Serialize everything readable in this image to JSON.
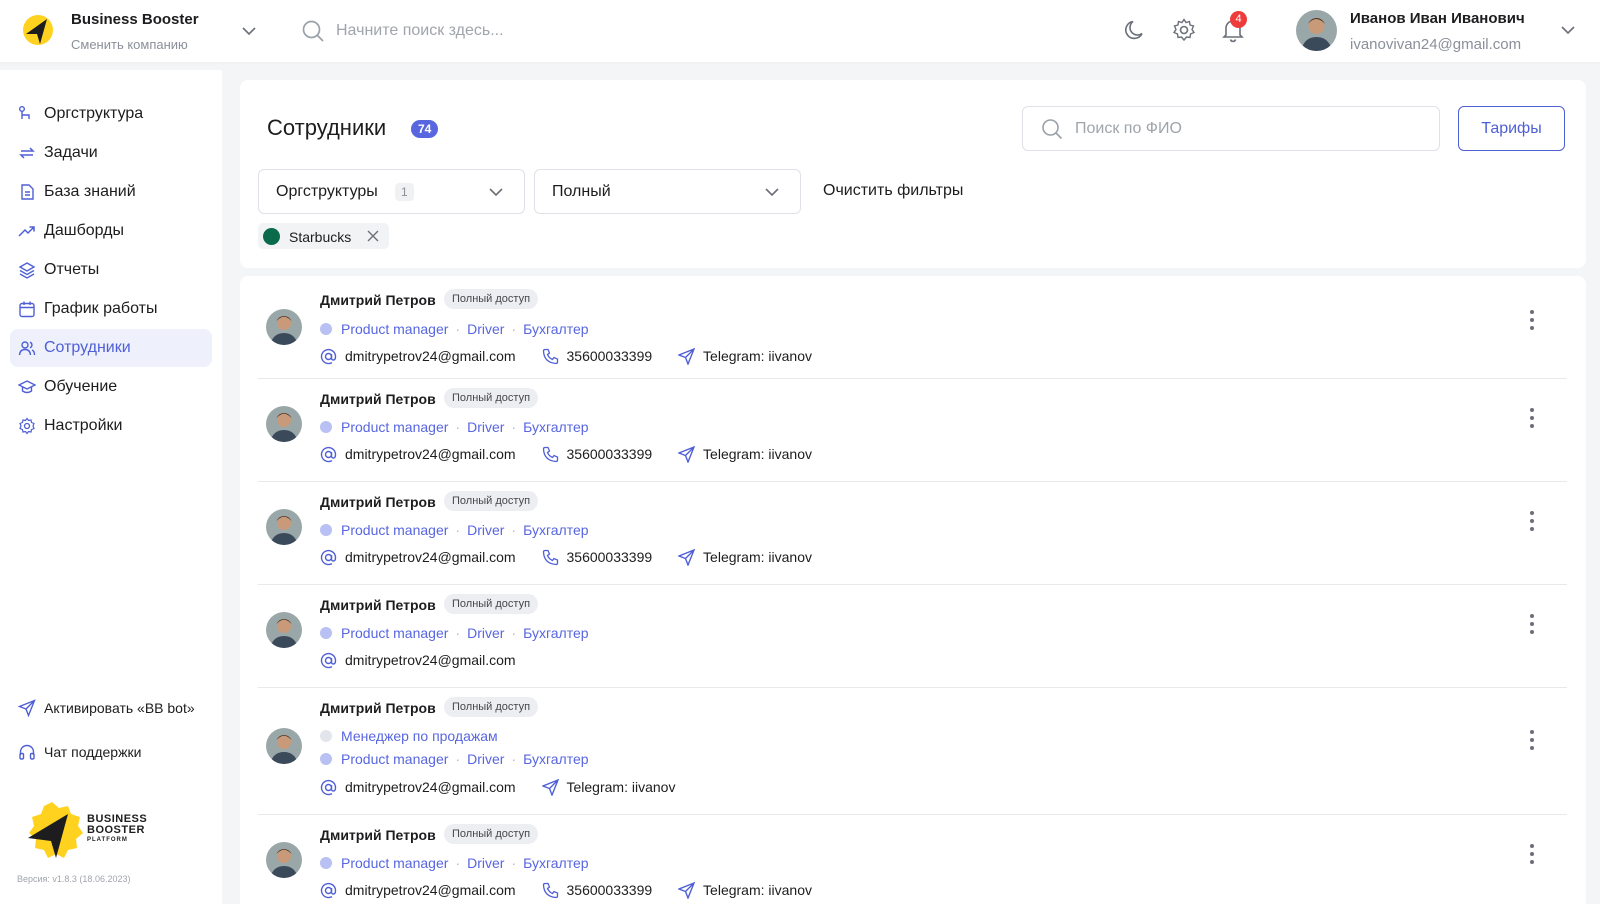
{
  "header": {
    "company_name": "Business Booster",
    "company_switch": "Сменить компанию",
    "search_placeholder": "Начните поиск здесь...",
    "notifications_count": "4",
    "user_name": "Иванов Иван Иванович",
    "user_email": "ivanovivan24@gmail.com",
    "icons": [
      "moon-icon",
      "gear-icon",
      "bell-icon",
      "chevron-down-icon",
      "search-icon"
    ]
  },
  "sidebar": {
    "items": [
      {
        "label": "Оргструктура",
        "icon": "org-icon"
      },
      {
        "label": "Задачи",
        "icon": "tasks-icon"
      },
      {
        "label": "База знаний",
        "icon": "document-icon"
      },
      {
        "label": "Дашборды",
        "icon": "trend-icon"
      },
      {
        "label": "Отчеты",
        "icon": "layers-icon"
      },
      {
        "label": "График работы",
        "icon": "calendar-icon"
      },
      {
        "label": "Сотрудники",
        "icon": "users-icon",
        "active": true
      },
      {
        "label": "Обучение",
        "icon": "graduation-icon"
      },
      {
        "label": "Настройки",
        "icon": "gear-icon"
      }
    ],
    "activate_bot": "Активировать «BB bot»",
    "support_chat": "Чат поддержки",
    "brand_line1": "BUSINESS",
    "brand_line2": "BOOSTER",
    "brand_line3": "PLATFORM",
    "version": "Версия: v1.8.3 (18.06.2023)"
  },
  "main": {
    "title": "Сотрудники",
    "count": "74",
    "fio_placeholder": "Поиск по ФИО",
    "tariff_button": "Тарифы",
    "filter_org_label": "Оргструктуры",
    "filter_org_count": "1",
    "filter_access_label": "Полный",
    "clear_filters": "Очистить фильтры",
    "chip_label": "Starbucks"
  },
  "employees": [
    {
      "name": "Дмитрий Петров",
      "access": "Полный доступ",
      "roles": [
        "Product manager",
        "Driver",
        "Бухгалтер"
      ],
      "email": "dmitrypetrov24@gmail.com",
      "phone": "35600033399",
      "telegram": "Telegram: iivanov"
    },
    {
      "name": "Дмитрий Петров",
      "access": "Полный доступ",
      "roles": [
        "Product manager",
        "Driver",
        "Бухгалтер"
      ],
      "email": "dmitrypetrov24@gmail.com",
      "phone": "35600033399",
      "telegram": "Telegram: iivanov"
    },
    {
      "name": "Дмитрий Петров",
      "access": "Полный доступ",
      "roles": [
        "Product manager",
        "Driver",
        "Бухгалтер"
      ],
      "email": "dmitrypetrov24@gmail.com",
      "phone": "35600033399",
      "telegram": "Telegram: iivanov"
    },
    {
      "name": "Дмитрий Петров",
      "access": "Полный доступ",
      "roles": [
        "Product manager",
        "Driver",
        "Бухгалтер"
      ],
      "email": "dmitrypetrov24@gmail.com"
    },
    {
      "name": "Дмитрий Петров",
      "access": "Полный доступ",
      "extra_role": "Менеджер по продажам",
      "roles": [
        "Product manager",
        "Driver",
        "Бухгалтер"
      ],
      "email": "dmitrypetrov24@gmail.com",
      "telegram": "Telegram: iivanov"
    },
    {
      "name": "Дмитрий Петров",
      "access": "Полный доступ",
      "roles": [
        "Product manager",
        "Driver",
        "Бухгалтер"
      ],
      "email": "dmitrypetrov24@gmail.com",
      "phone": "35600033399",
      "telegram": "Telegram: iivanov"
    }
  ]
}
